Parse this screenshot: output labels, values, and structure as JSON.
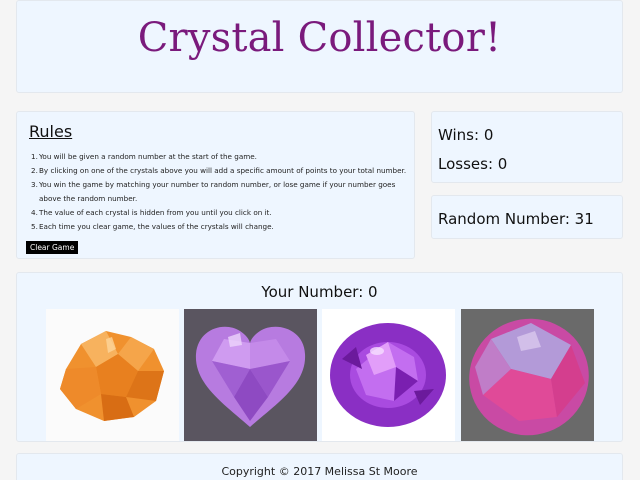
{
  "header": {
    "title": "Crystal Collector!"
  },
  "rules": {
    "heading": "Rules",
    "items": [
      {
        "num": "1.",
        "text": "You will be given a random number at the start of the game."
      },
      {
        "num": "2.",
        "text": "By clicking on one of the crystals above you will add a specific amount of points to your total number."
      },
      {
        "num": "3.",
        "text": "You win the game by matching your number to random number, or lose game if your number goes above the random number."
      },
      {
        "num": "4.",
        "text": "The value of each crystal is hidden from you until you click on it."
      },
      {
        "num": "5.",
        "text": "Each time you clear game, the values of the crystals will change."
      }
    ],
    "clear_button": "Clear Game"
  },
  "score": {
    "wins": "Wins: 0",
    "losses": "Losses: 0"
  },
  "random": {
    "label": "Random Number: 31"
  },
  "crystals": {
    "your_number": "Your Number: 0",
    "items": [
      {
        "name": "orange-crystal"
      },
      {
        "name": "heart-amethyst-crystal"
      },
      {
        "name": "oval-purple-crystal"
      },
      {
        "name": "pink-oval-crystal"
      }
    ]
  },
  "footer": {
    "copyright": "Copyright © 2017 Melissa St Moore"
  }
}
